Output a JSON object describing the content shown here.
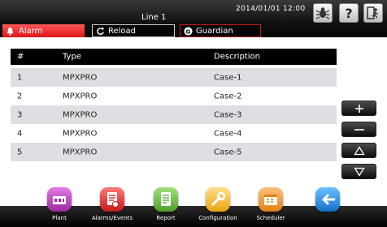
{
  "header": {
    "line_title": "Line 1",
    "datetime": "2014/01/01  12:00",
    "tabs": {
      "alarm": "Alarm",
      "reload": "Reload",
      "guardian": "Guardian"
    }
  },
  "table": {
    "columns": [
      "#",
      "Type",
      "Description"
    ],
    "rows": [
      {
        "num": "1",
        "type": "MPXPRO",
        "desc": "Case-1"
      },
      {
        "num": "2",
        "type": "MPXPRO",
        "desc": "Case-2"
      },
      {
        "num": "3",
        "type": "MPXPRO",
        "desc": "Case-3"
      },
      {
        "num": "4",
        "type": "MPXPRO",
        "desc": "Case-4"
      },
      {
        "num": "5",
        "type": "MPXPRO",
        "desc": "Case-5"
      }
    ]
  },
  "dock": {
    "plant": "Plant",
    "alarms_events": "Alarms/Events",
    "report": "Report",
    "configuration": "Configuration",
    "scheduler": "Scheduler"
  },
  "colors": {
    "alarm_red": "#e01414",
    "guardian_red": "#c41a1a",
    "row_shade": "#dddfe2",
    "plant_purple": "#b03ab6",
    "alarms_red": "#d62b2b",
    "report_green": "#64b83a",
    "config_yellow": "#f2b81e",
    "scheduler_orange": "#f09a1e",
    "back_blue": "#1a8fe0"
  }
}
